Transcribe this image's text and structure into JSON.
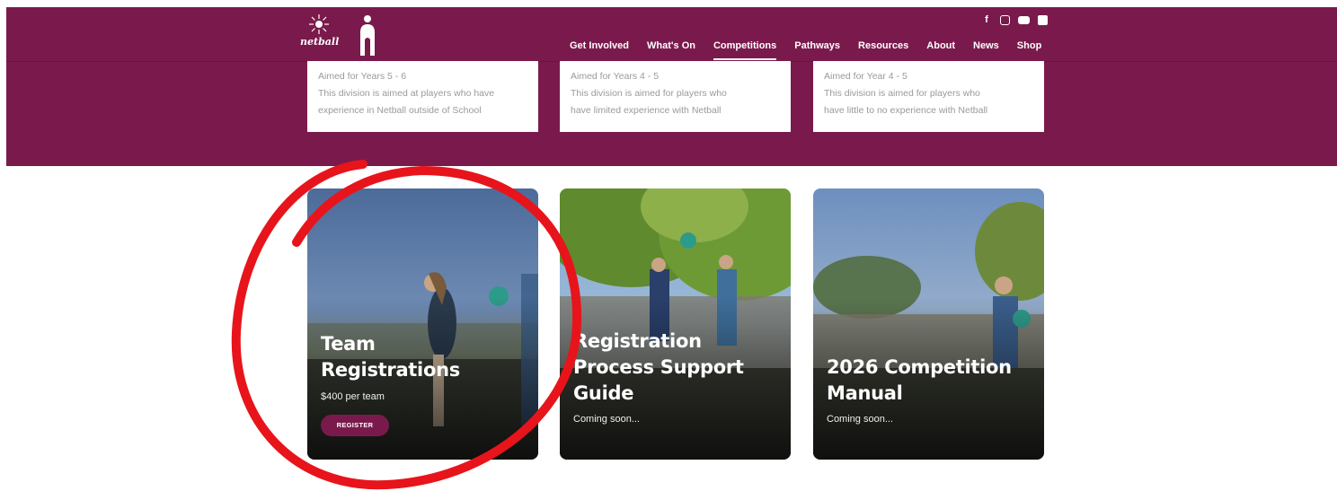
{
  "brand": {
    "logo_text": "netball"
  },
  "social": {
    "icons": [
      "facebook-icon",
      "instagram-icon",
      "youtube-icon",
      "linkedin-icon"
    ]
  },
  "nav": {
    "items": [
      "Get Involved",
      "What's On",
      "Competitions",
      "Pathways",
      "Resources",
      "About",
      "News",
      "Shop"
    ],
    "active": "Competitions"
  },
  "divisions": [
    {
      "age": "Aimed for Years 5 - 6",
      "desc_1": "This division is aimed at players who have",
      "desc_2": "experience in Netball outside of School"
    },
    {
      "age": "Aimed for Years 4 - 5",
      "desc_1": "This division is aimed for players who",
      "desc_2": "have limited experience with Netball"
    },
    {
      "age": "Aimed for Year 4 - 5",
      "desc_1": "This division is aimed for players who",
      "desc_2": "have little to no experience with Netball"
    }
  ],
  "cards": [
    {
      "title_1": "Team",
      "title_2": "Registrations",
      "subtitle": "$400 per team",
      "button": "REGISTER"
    },
    {
      "title_1": "Registration",
      "title_2": "Process Support",
      "title_3": "Guide",
      "subtitle": "Coming soon..."
    },
    {
      "title_1": "2026 Competition",
      "title_2": "Manual",
      "subtitle": "Coming soon..."
    }
  ],
  "colors": {
    "brand": "#7a1a4c",
    "annotation": "#e8141b"
  }
}
